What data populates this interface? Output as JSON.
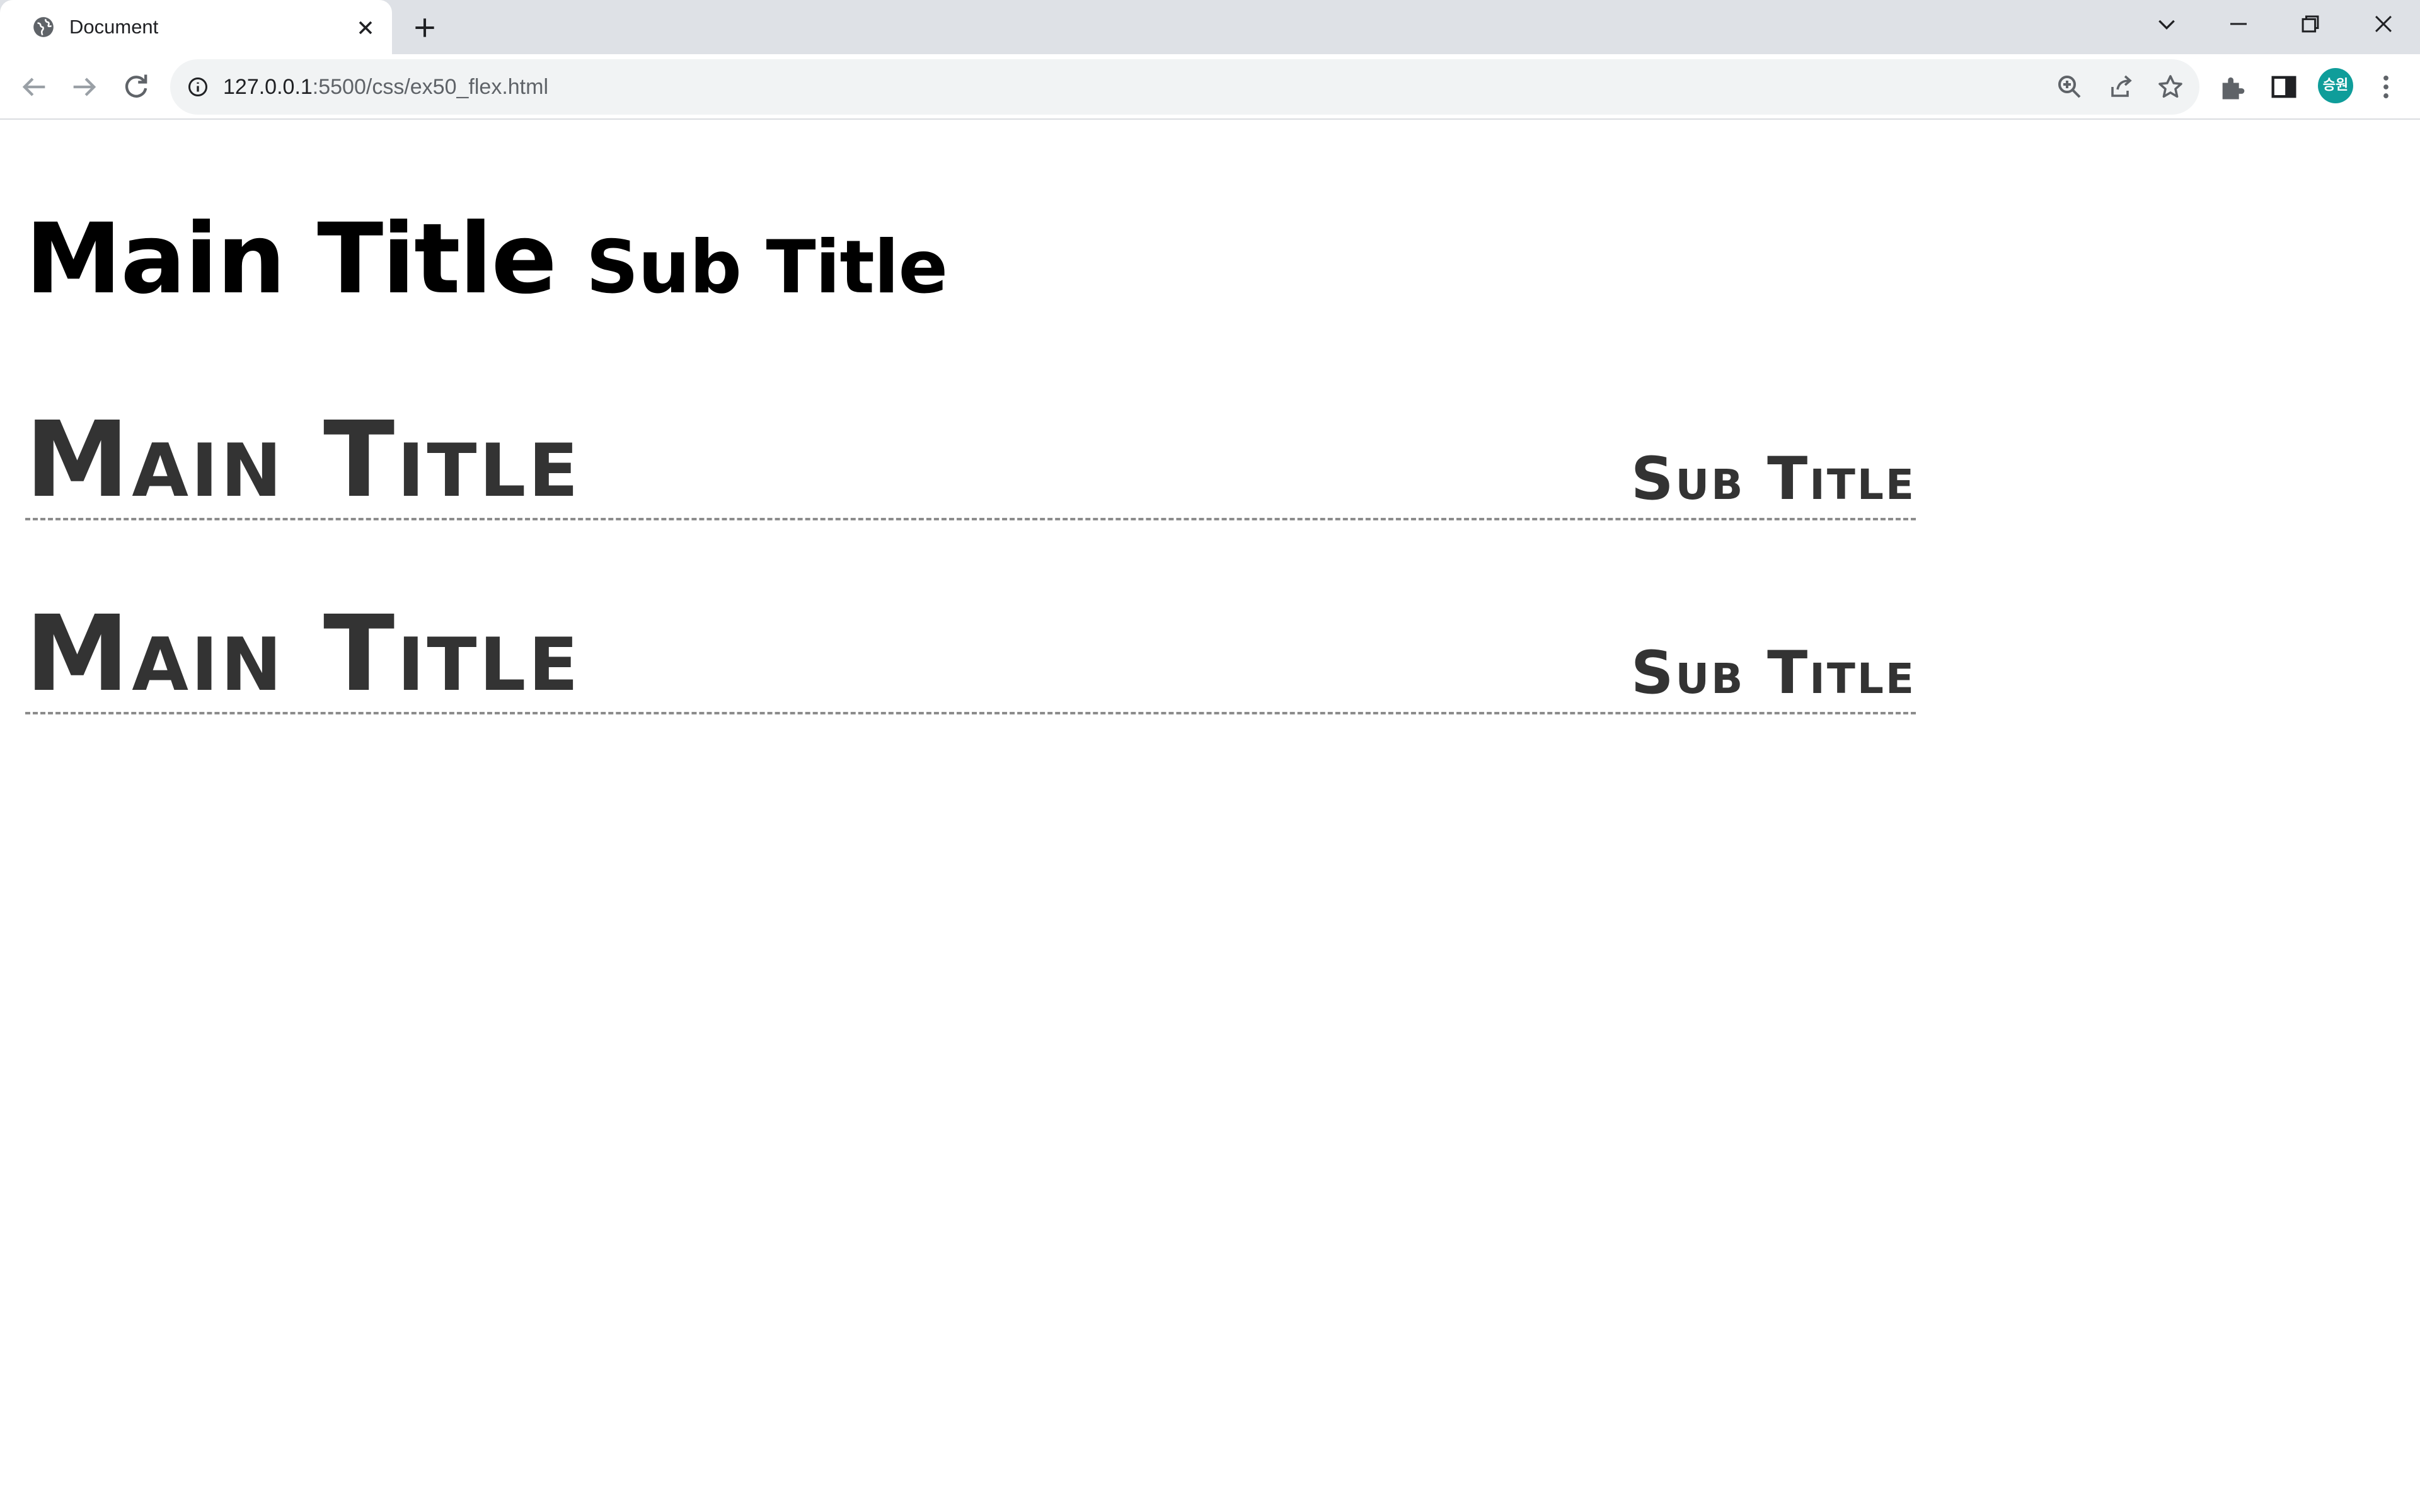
{
  "browser": {
    "tab": {
      "title": "Document",
      "favicon": "globe-icon"
    },
    "address_bar": {
      "host": "127.0.0.1",
      "path": ":5500/css/ex50_flex.html"
    },
    "profile": {
      "initials": "승원",
      "color": "#0f9d9a"
    },
    "icons": [
      "globe-icon",
      "close-icon",
      "plus-icon",
      "chevron-down-icon",
      "minimize-icon",
      "restore-icon",
      "close-window-icon",
      "back-arrow-icon",
      "forward-arrow-icon",
      "reload-icon",
      "info-icon",
      "zoom-icon",
      "share-icon",
      "star-icon",
      "puzzle-icon",
      "side-panel-icon",
      "kebab-menu-icon"
    ]
  },
  "page": {
    "heading1": {
      "main": "Main Title",
      "sub": "Sub Title"
    },
    "heading2": {
      "main": "Main Title",
      "sub": "Sub Title"
    },
    "heading3": {
      "main": "Main Title",
      "sub": "Sub Title"
    }
  },
  "colors": {
    "heading_plain": "#000000",
    "heading_flex": "#333333",
    "dashed_border": "#8c8c8c"
  }
}
